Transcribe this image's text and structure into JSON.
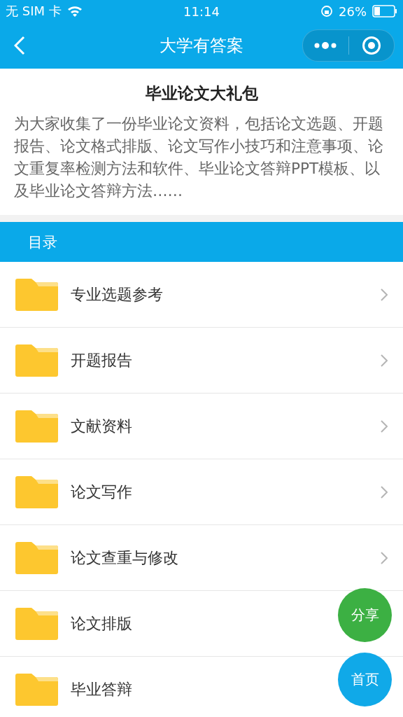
{
  "status_bar": {
    "carrier": "无 SIM 卡",
    "time": "11:14",
    "battery": "26%"
  },
  "nav": {
    "title": "大学有答案"
  },
  "intro": {
    "title": "毕业论文大礼包",
    "text": "为大家收集了一份毕业论文资料，包括论文选题、开题报告、论文格式排版、论文写作小技巧和注意事项、论文重复率检测方法和软件、毕业论文答辩PPT模板、以及毕业论文答辩方法……"
  },
  "catalog": {
    "heading": "目录",
    "items": [
      {
        "label": "专业选题参考"
      },
      {
        "label": "开题报告"
      },
      {
        "label": "文献资料"
      },
      {
        "label": "论文写作"
      },
      {
        "label": "论文查重与修改"
      },
      {
        "label": "论文排版"
      },
      {
        "label": "毕业答辩"
      }
    ]
  },
  "floating_buttons": [
    {
      "label": "分享",
      "color": "#3cb043"
    },
    {
      "label": "首页",
      "color": "#10a9e8"
    }
  ]
}
